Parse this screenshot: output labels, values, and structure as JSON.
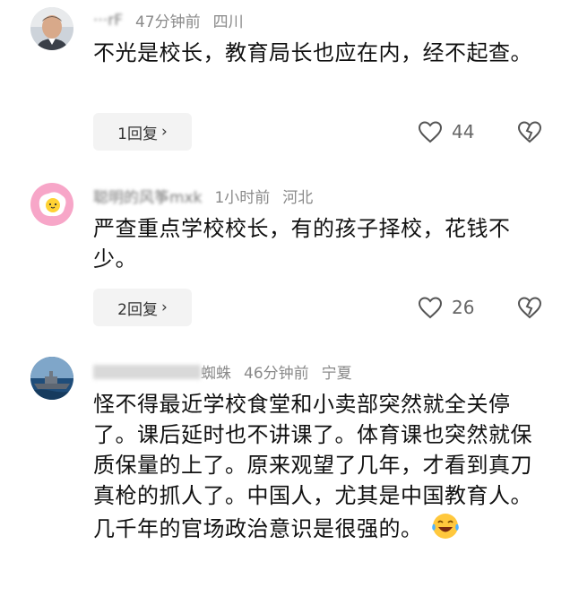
{
  "comments": [
    {
      "name": "···rF",
      "time": "47分钟前",
      "location": "四川",
      "text": "不光是校长，教育局长也应在内，经不起查。",
      "reply_label": "1回复",
      "likes": "44",
      "avatar": "elderly-man-avatar"
    },
    {
      "name": "聪明的风筝mxk",
      "time": "1小时前",
      "location": "河北",
      "text": "严查重点学校校长，有的孩子择校，花钱不少。",
      "reply_label": "2回复",
      "likes": "26",
      "avatar": "fried-egg-avatar"
    },
    {
      "name": "蜘蛛",
      "time": "46分钟前",
      "location": "宁夏",
      "text": "怪不得最近学校食堂和小卖部突然就全关停了。课后延时也不讲课了。体育课也突然就保质保量的上了。原来观望了几年，才看到真刀真枪的抓人了。中国人，尤其是中国教育人。几千年的官场政治意识是很强的。",
      "avatar": "warship-avatar",
      "emoji": "laughing-crying-emoji"
    }
  ],
  "colors": {
    "meta_gray": "#8a8a8a",
    "reply_bg": "#f3f3f3"
  }
}
